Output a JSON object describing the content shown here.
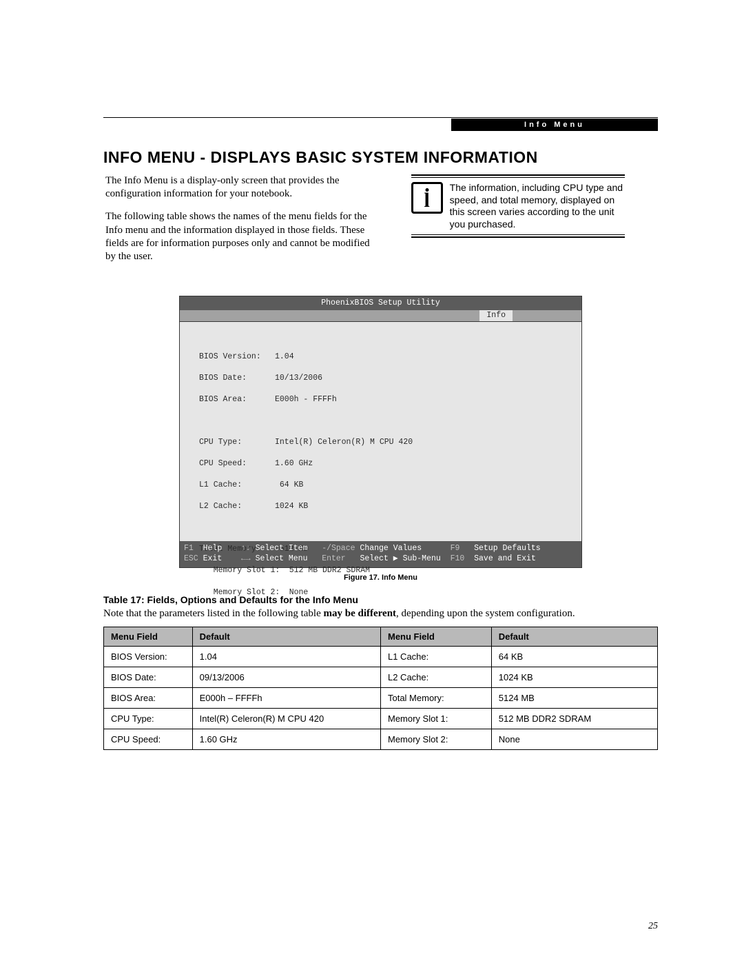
{
  "header": {
    "section_label": "Info Menu"
  },
  "title": "INFO MENU - DISPLAYS BASIC SYSTEM INFORMATION",
  "intro": {
    "p1": "The Info Menu is a display-only screen that provides the configuration information for your notebook.",
    "p2": "The following table shows the names of the menu fields for the Info menu and the information displayed in those fields. These fields are for information purposes only and cannot be modified by the user."
  },
  "note": {
    "text": "The information, including CPU type and speed, and total memory, displayed on this screen varies according to the unit you purchased."
  },
  "bios": {
    "title": "PhoenixBIOS Setup Utility",
    "tab": "Info",
    "fields": {
      "bios_version_label": "BIOS Version:",
      "bios_version": "1.04",
      "bios_date_label": "BIOS Date:",
      "bios_date": "10/13/2006",
      "bios_area_label": "BIOS Area:",
      "bios_area": "E000h - FFFFh",
      "cpu_type_label": "CPU Type:",
      "cpu_type": "Intel(R) Celeron(R) M CPU 420",
      "cpu_speed_label": "CPU Speed:",
      "cpu_speed": "1.60 GHz",
      "l1_label": "L1 Cache:",
      "l1": " 64 KB",
      "l2_label": "L2 Cache:",
      "l2": "1024 KB",
      "mem_label": "Total Memory:",
      "mem": " 512 MB",
      "slot1_label": "Memory Slot 1:",
      "slot1": "512 MB DDR2 SDRAM",
      "slot2_label": "Memory Slot 2:",
      "slot2": "None"
    },
    "footer": {
      "f1": "F1",
      "help": "Help",
      "esc": "ESC",
      "exit": "Exit",
      "ud": "↑↓",
      "selitem": "Select Item",
      "lr": "←→",
      "selmenu": "Select Menu",
      "ms": "-/Space",
      "chval": "Change Values",
      "enter": "Enter",
      "selsub": "Select ▶ Sub-Menu",
      "f9": "F9",
      "setdef": "Setup Defaults",
      "f10": "F10",
      "savex": "Save and Exit"
    }
  },
  "figure_caption": "Figure 17.  Info Menu",
  "table_caption": "Table 17: Fields, Options and Defaults for the Info Menu",
  "table_note_pre": "Note that the parameters listed in the following table ",
  "table_note_bold": "may be different",
  "table_note_post": ", depending upon the system configuration.",
  "table": {
    "headers": {
      "mf": "Menu Field",
      "def": "Default"
    },
    "rows": [
      {
        "l": "BIOS Version:",
        "lv": "1.04",
        "r": "L1 Cache:",
        "rv": "64 KB"
      },
      {
        "l": "BIOS Date:",
        "lv": "09/13/2006",
        "r": "L2 Cache:",
        "rv": "1024 KB"
      },
      {
        "l": "BIOS Area:",
        "lv": "E000h – FFFFh",
        "r": "Total Memory:",
        "rv": "5124 MB"
      },
      {
        "l": "CPU Type:",
        "lv": "Intel(R) Celeron(R) M CPU 420",
        "r": "Memory Slot 1:",
        "rv": "512 MB DDR2 SDRAM"
      },
      {
        "l": "CPU Speed:",
        "lv": "1.60 GHz",
        "r": "Memory Slot 2:",
        "rv": "None"
      }
    ]
  },
  "page_number": "25"
}
